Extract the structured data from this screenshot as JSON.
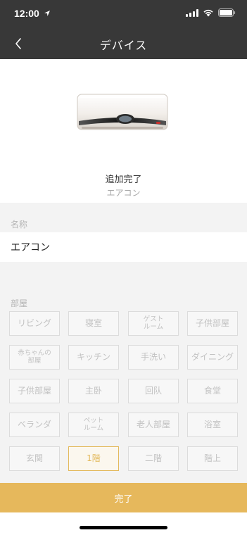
{
  "status_bar": {
    "time": "12:00"
  },
  "nav": {
    "title": "デバイス"
  },
  "device": {
    "status": "追加完了",
    "type": "エアコン"
  },
  "name_section": {
    "label": "名称",
    "value": "エアコン"
  },
  "room_section": {
    "label": "部屋",
    "rooms": [
      {
        "label": "リビング",
        "selected": false
      },
      {
        "label": "寝室",
        "selected": false
      },
      {
        "label": "ゲスト\nルーム",
        "selected": false
      },
      {
        "label": "子供部屋",
        "selected": false
      },
      {
        "label": "赤ちゃんの\n部屋",
        "selected": false
      },
      {
        "label": "キッチン",
        "selected": false
      },
      {
        "label": "手洗い",
        "selected": false
      },
      {
        "label": "ダイニング",
        "selected": false
      },
      {
        "label": "子供部屋",
        "selected": false
      },
      {
        "label": "主卧",
        "selected": false
      },
      {
        "label": "回队",
        "selected": false
      },
      {
        "label": "食堂",
        "selected": false
      },
      {
        "label": "ベランダ",
        "selected": false
      },
      {
        "label": "ペット\nルーム",
        "selected": false
      },
      {
        "label": "老人部屋",
        "selected": false
      },
      {
        "label": "浴室",
        "selected": false
      },
      {
        "label": "玄関",
        "selected": false
      },
      {
        "label": "1階",
        "selected": true
      },
      {
        "label": "二階",
        "selected": false
      },
      {
        "label": "階上",
        "selected": false
      }
    ]
  },
  "done_button": {
    "label": "完了"
  },
  "colors": {
    "accent": "#e6b85c",
    "nav_bg": "#383838",
    "page_bg": "#f3f3f3"
  },
  "icons": [
    "location-arrow-icon",
    "signal-icon",
    "wifi-icon",
    "battery-icon",
    "back-chevron-icon"
  ]
}
